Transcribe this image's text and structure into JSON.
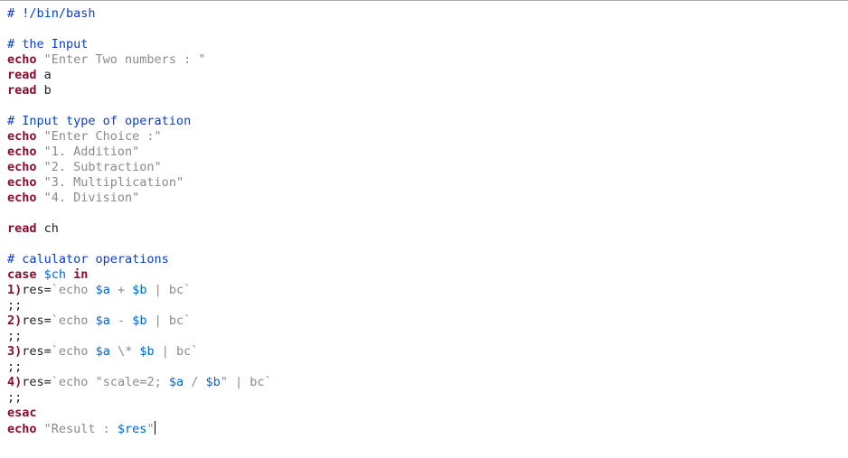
{
  "code": {
    "l1": {
      "comment": "# !/bin/bash"
    },
    "l3": {
      "comment": "# the Input"
    },
    "l4": {
      "kw": "echo",
      "str": " \"Enter Two numbers : \""
    },
    "l5": {
      "kw": "read",
      "rest": " a"
    },
    "l6": {
      "kw": "read",
      "rest": " b"
    },
    "l8": {
      "comment": "# Input type of operation"
    },
    "l9": {
      "kw": "echo",
      "str": " \"Enter Choice :\""
    },
    "l10": {
      "kw": "echo",
      "str": " \"1. Addition\""
    },
    "l11": {
      "kw": "echo",
      "str": " \"2. Subtraction\""
    },
    "l12": {
      "kw": "echo",
      "str": " \"3. Multiplication\""
    },
    "l13": {
      "kw": "echo",
      "str": " \"4. Division\""
    },
    "l15": {
      "kw": "read",
      "rest": " ch"
    },
    "l17": {
      "comment": "# calulator operations"
    },
    "l18": {
      "kw1": "case",
      "var": " $ch",
      "kw2": " in"
    },
    "l19": {
      "label": "1)",
      "assign": "res=",
      "tick1": "`",
      "kw": "echo",
      "sp1": " ",
      "v1": "$a",
      "op": " + ",
      "v2": "$b",
      "pipe": " | bc",
      "tick2": "`"
    },
    "l20": {
      "dsemi": ";;"
    },
    "l21": {
      "label": "2)",
      "assign": "res=",
      "tick1": "`",
      "kw": "echo",
      "sp1": " ",
      "v1": "$a",
      "op": " - ",
      "v2": "$b",
      "pipe": " | bc",
      "tick2": "`"
    },
    "l22": {
      "dsemi": ";;"
    },
    "l23": {
      "label": "3)",
      "assign": "res=",
      "tick1": "`",
      "kw": "echo",
      "sp1": " ",
      "v1": "$a",
      "op": " \\* ",
      "v2": "$b",
      "pipe": " | bc",
      "tick2": "`"
    },
    "l24": {
      "dsemi": ";;"
    },
    "l25": {
      "label": "4)",
      "assign": "res=",
      "tick1": "`",
      "kw": "echo",
      "sp1": " ",
      "q1": "\"scale=2; ",
      "v1": "$a",
      "op": " / ",
      "v2": "$b",
      "q2": "\"",
      "pipe": " | bc",
      "tick2": "`"
    },
    "l26": {
      "dsemi": ";;"
    },
    "l27": {
      "kw": "esac"
    },
    "l28": {
      "kw": "echo",
      "q1": " \"Result : ",
      "var": "$res",
      "q2": "\""
    }
  }
}
